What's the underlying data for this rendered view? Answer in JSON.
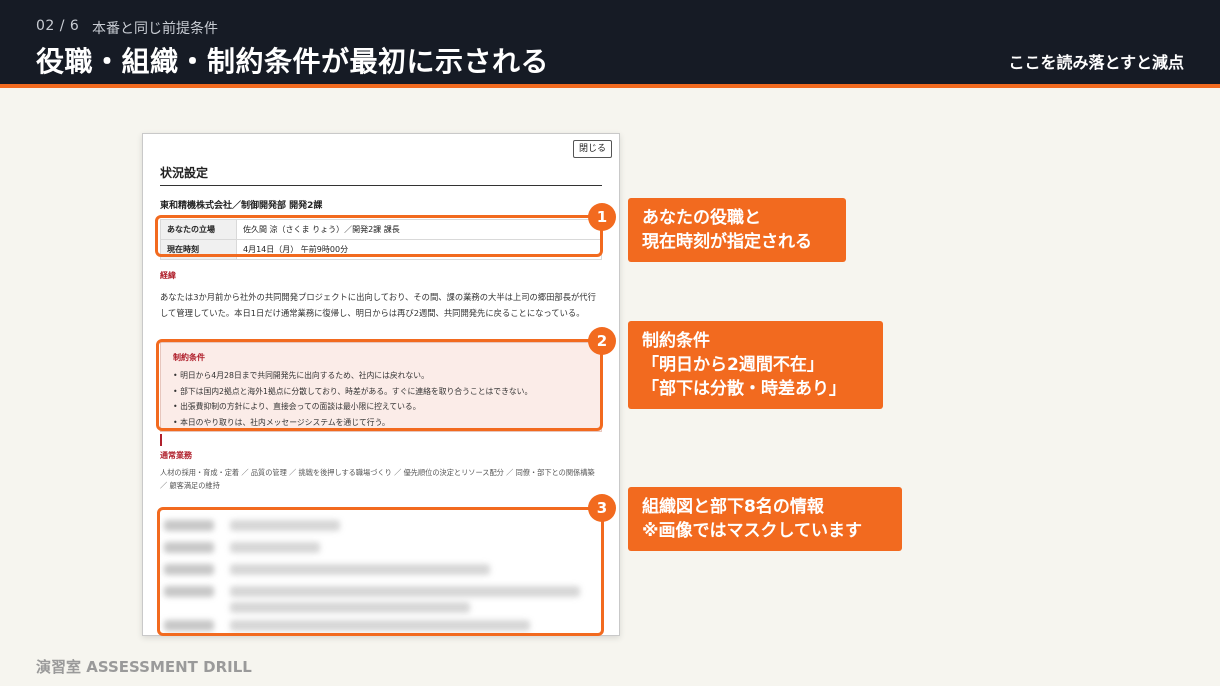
{
  "header": {
    "slide_no": "02 / 6",
    "section": "本番と同じ前提条件",
    "title": "役職・組織・制約条件が最初に示される",
    "warning": "ここを読み落とすと減点"
  },
  "doc": {
    "close_label": "閉じる",
    "title": "状況設定",
    "company": "東和精機株式会社／制御開発部 開発2課",
    "table": [
      {
        "key": "あなたの立場",
        "value": "佐久間 涼（さくま りょう）／開発2課 課長"
      },
      {
        "key": "現在時刻",
        "value": "4月14日（月） 午前9時00分"
      }
    ],
    "background_heading": "経緯",
    "background_text": "あなたは3か月前から社外の共同開発プロジェクトに出向しており、その間、課の業務の大半は上司の郷田部長が代行して管理していた。本日1日だけ通常業務に復帰し、明日からは再び2週間、共同開発先に戻ることになっている。",
    "constraints_heading": "制約条件",
    "constraints": [
      "明日から4月28日まで共同開発先に出向するため、社内には戻れない。",
      "部下は国内2拠点と海外1拠点に分散しており、時差がある。すぐに連絡を取り合うことはできない。",
      "出張費抑制の方針により、直接会っての面談は最小限に控えている。",
      "本日のやり取りは、社内メッセージシステムを通じて行う。"
    ],
    "duties_heading": "通常業務",
    "duties_text": "人材の採用・育成・定着 ／ 品質の管理 ／ 挑戦を後押しする職場づくり ／ 優先順位の決定とリソース配分 ／ 同僚・部下との関係構築 ／ 顧客満足の維持"
  },
  "callouts": [
    {
      "num": "1",
      "line1": "あなたの役職と",
      "line2": "現在時刻が指定される",
      "line3": ""
    },
    {
      "num": "2",
      "line1": "制約条件",
      "line2": "「明日から2週間不在」",
      "line3": "「部下は分散・時差あり」"
    },
    {
      "num": "3",
      "line1": "組織図と部下8名の情報",
      "line2": "※画像ではマスクしています",
      "line3": ""
    }
  ],
  "footer": "演習室 ASSESSMENT DRILL",
  "colors": {
    "accent": "#f26a1f",
    "header_bg": "#161b25",
    "page_bg": "#f6f5ef",
    "constraint_red": "#b0202c"
  }
}
